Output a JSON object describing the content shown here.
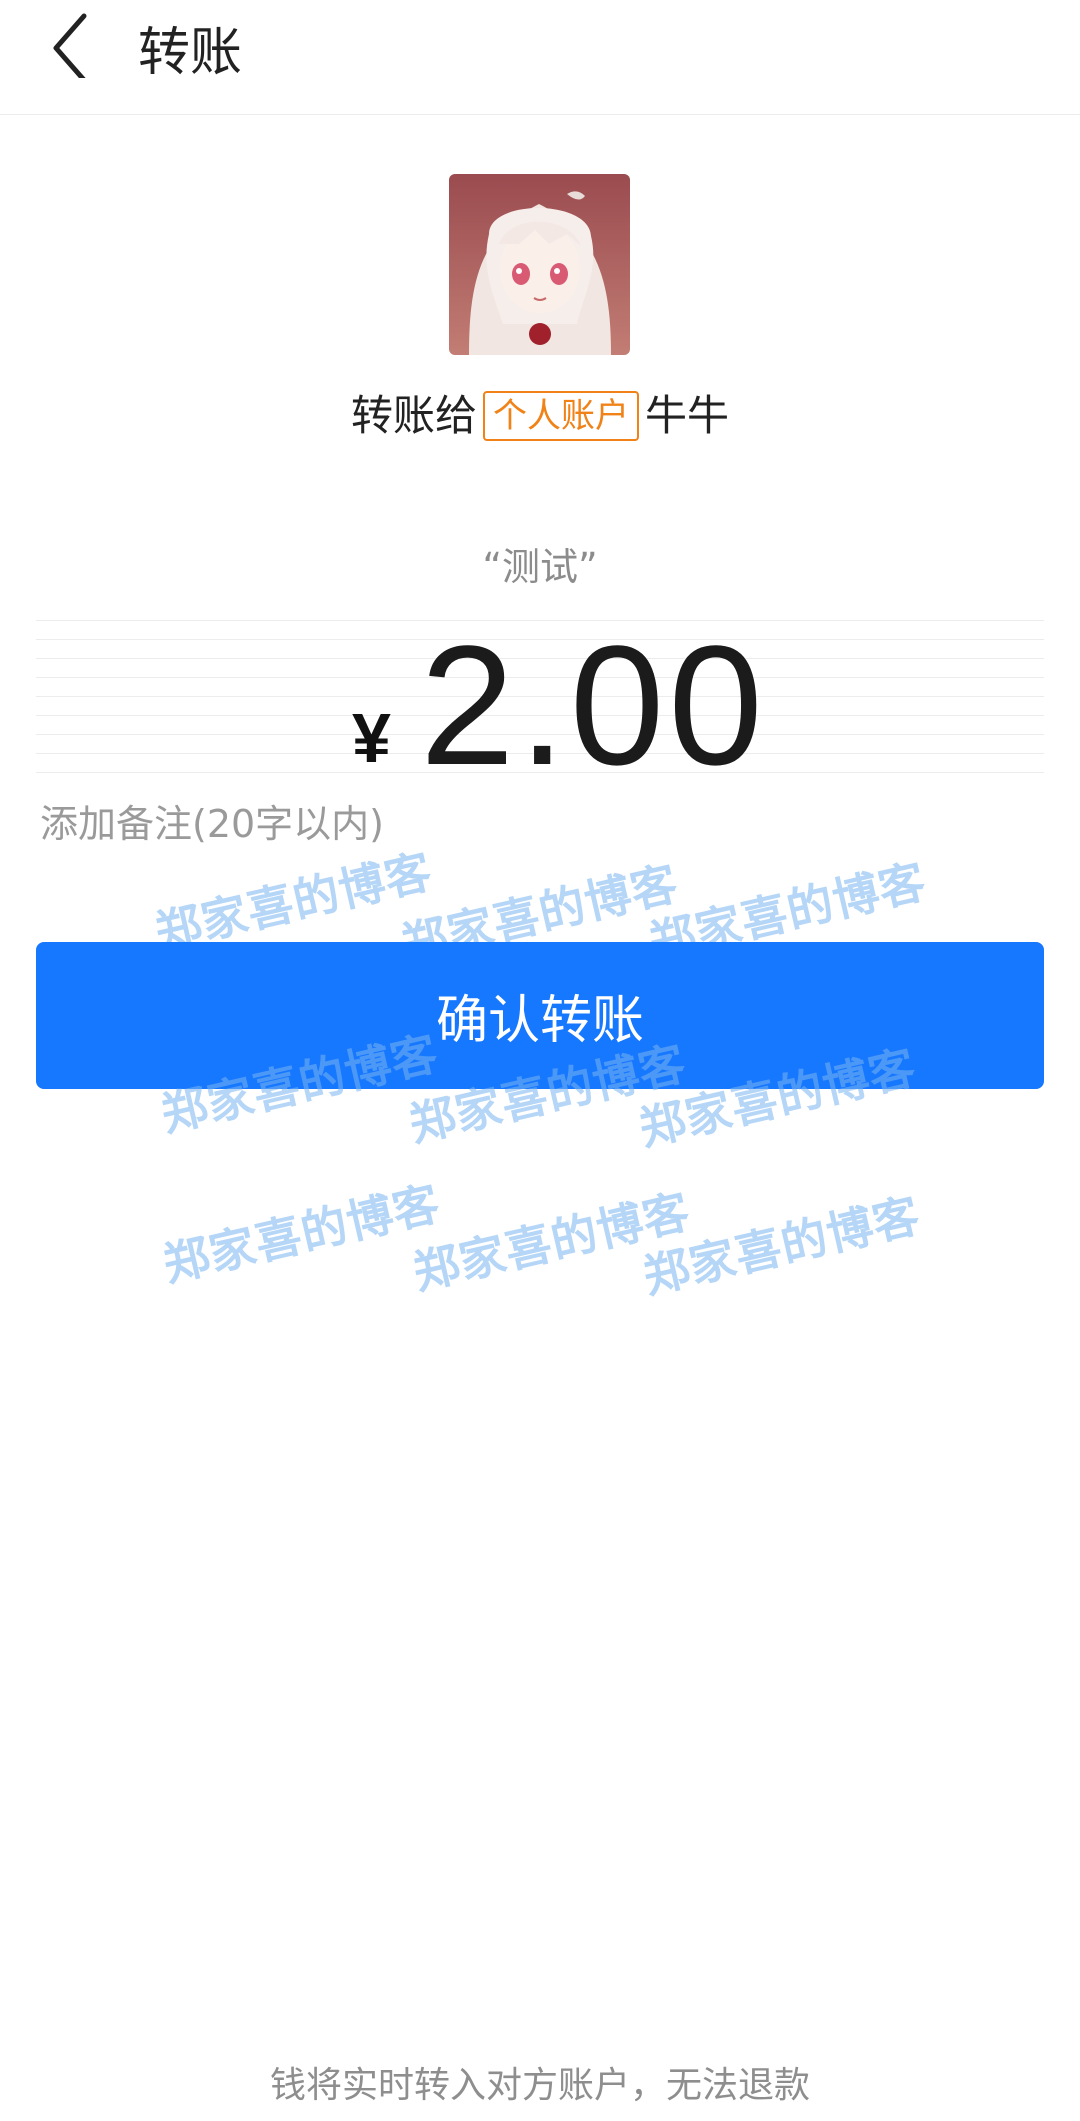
{
  "header": {
    "title": "转账",
    "back_icon": "chevron-left-icon"
  },
  "recipient": {
    "avatar": "anime-girl-avatar",
    "prefix": "转账给",
    "account_type_badge": "个人账户",
    "name": "牛牛"
  },
  "memo_display": "“测试”",
  "amount": {
    "currency_symbol": "¥",
    "value": "2.00"
  },
  "remark_input": {
    "placeholder": "添加备注(20字以内)",
    "value": ""
  },
  "confirm_button_label": "确认转账",
  "watermark": "郑家喜的博客",
  "footer_note": "钱将实时转入对方账户，无法退款",
  "colors": {
    "primary": "#1677ff",
    "badge": "#f08218",
    "watermark": "#78b4f0"
  }
}
